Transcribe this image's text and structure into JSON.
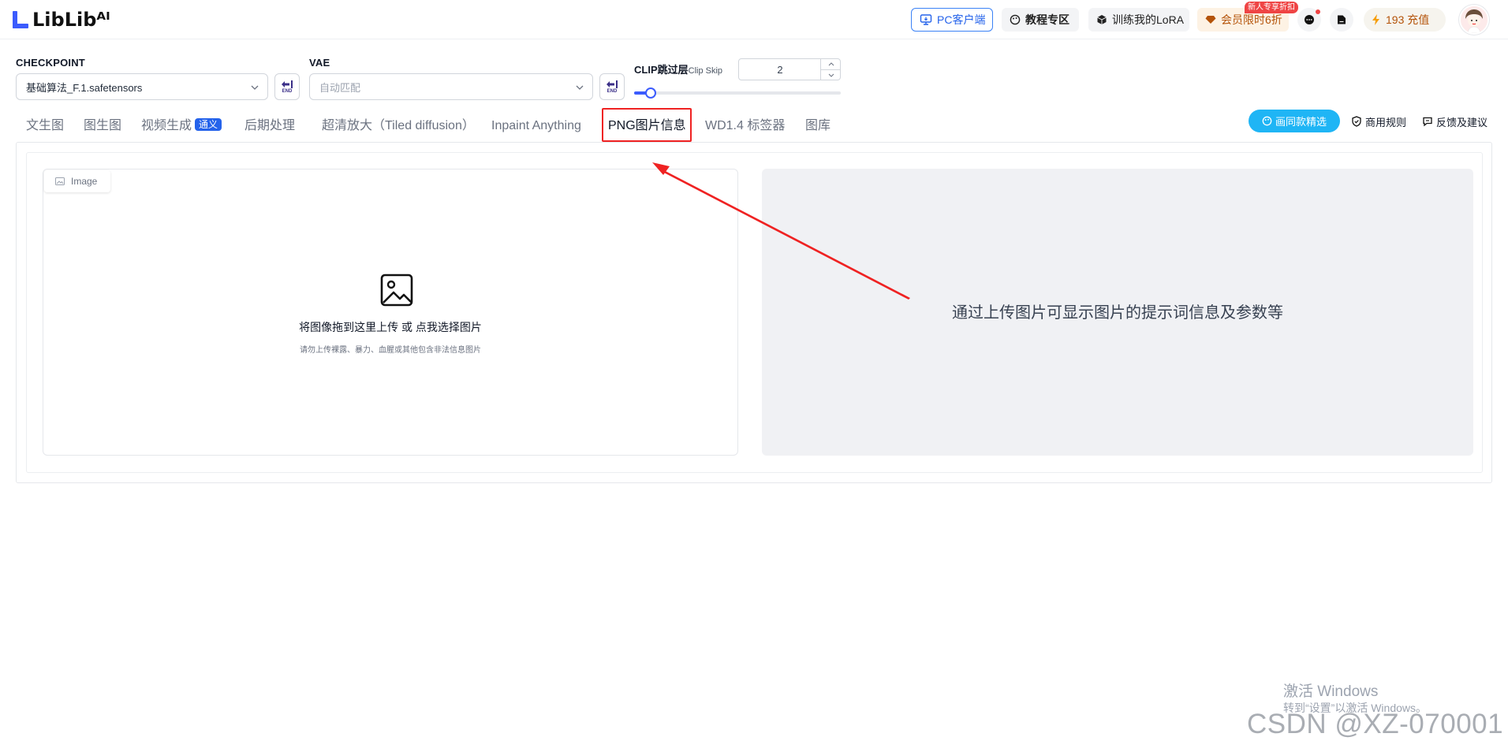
{
  "header": {
    "logo_text": "LibLibᴬᴵ",
    "pc_client": "PC客户端",
    "tutorial": "教程专区",
    "train_lora": "训练我的LoRA",
    "member": "会员限时6折",
    "member_badge": "新人专享折扣",
    "charge": "193 充值",
    "icons": [
      "monitor-icon",
      "palette-icon",
      "cube-icon",
      "diamond-icon",
      "chat-icon",
      "file-icon",
      "lightning-icon"
    ]
  },
  "model": {
    "checkpoint_label": "CHECKPOINT",
    "checkpoint_value": "基础算法_F.1.safetensors",
    "vae_label": "VAE",
    "vae_placeholder": "自动匹配",
    "end_label": "END",
    "clip_label": "CLIP跳过层",
    "clip_sub": "Clip Skip",
    "clip_value": "2",
    "clip_slider_fraction": 0.08
  },
  "tabs": [
    {
      "label": "文生图"
    },
    {
      "label": "图生图"
    },
    {
      "label": "视频生成",
      "tag": "通义"
    },
    {
      "label": "后期处理"
    },
    {
      "label": "超清放大（Tiled diffusion）"
    },
    {
      "label": "Inpaint Anything"
    },
    {
      "label": "PNG图片信息",
      "active": true
    },
    {
      "label": "WD1.4 标签器"
    },
    {
      "label": "图库"
    }
  ],
  "actions": {
    "same_style": "画同款精选",
    "rules": "商用规则",
    "feedback": "反馈及建议"
  },
  "upload": {
    "tag": "Image",
    "main_text": "将图像拖到这里上传 或 点我选择图片",
    "hint": "请勿上传裸露、暴力、血腥或其他包含非法信息图片"
  },
  "info": {
    "text": "通过上传图片可显示图片的提示词信息及参数等"
  },
  "colors": {
    "accent": "#3b5bfd",
    "annotation": "#ef2222",
    "pill": "#1fb5f5"
  },
  "watermark": {
    "windows_title": "激活 Windows",
    "windows_sub": "转到“设置”以激活 Windows。",
    "csdn": "CSDN @XZ-070001"
  }
}
